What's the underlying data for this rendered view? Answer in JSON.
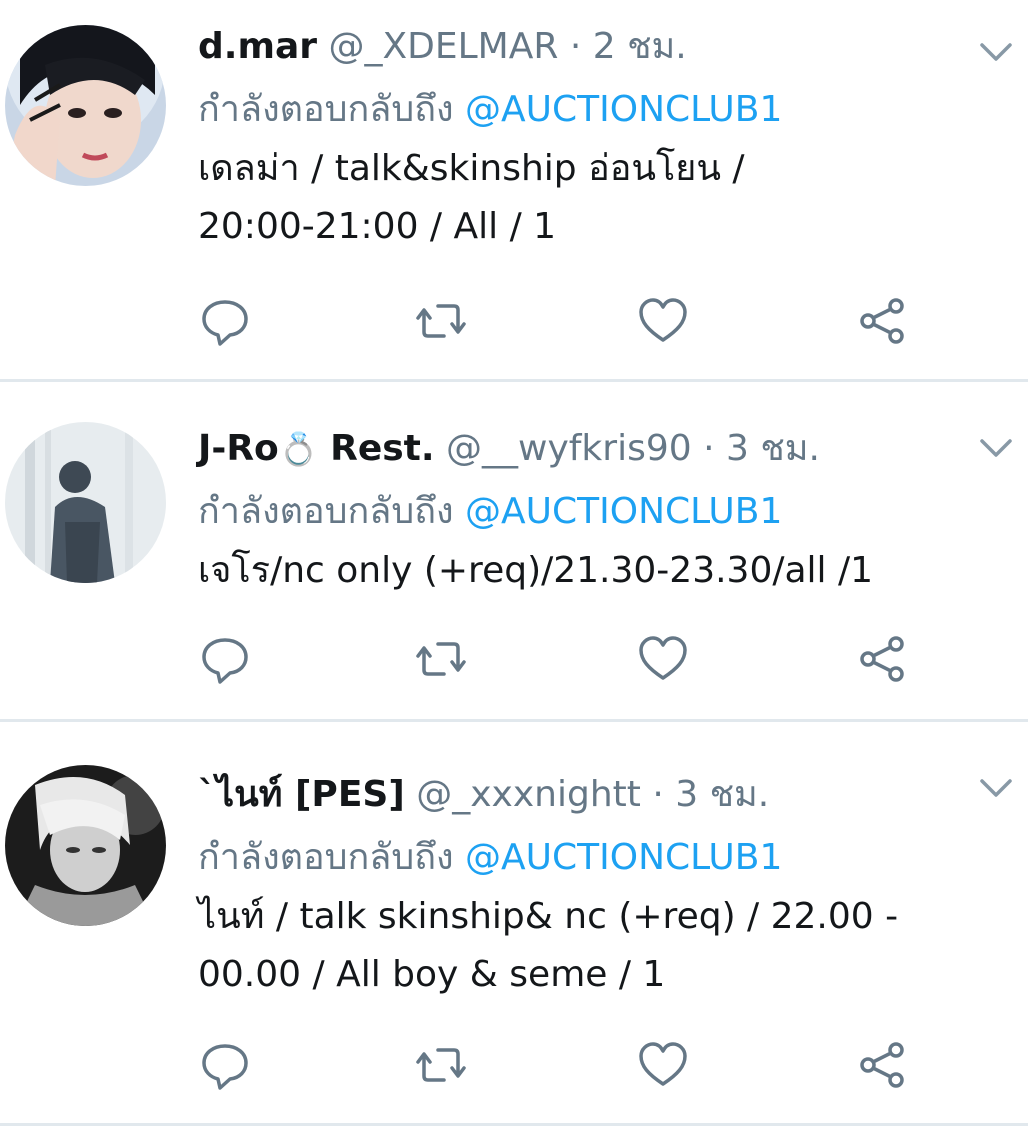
{
  "tweets": [
    {
      "name": "d.mar",
      "badge": "",
      "name_suffix": "",
      "handle": "@_XDELMAR",
      "separator": "·",
      "time": "2 ชม.",
      "replying_prefix": "กำลังตอบกลับถึง",
      "replying_to": "@AUCTIONCLUB1",
      "text_lines": [
        "เดลม่า / talk&skinship อ่อนโยน /",
        "20:00-21:00 / All / 1"
      ]
    },
    {
      "name": "J-Ro",
      "badge": "💍",
      "name_suffix": "Rest.",
      "handle": "@__wyfkris90",
      "separator": "·",
      "time": "3 ชม.",
      "replying_prefix": "กำลังตอบกลับถึง",
      "replying_to": "@AUCTIONCLUB1",
      "text_lines": [
        "เจโร/nc only (+req)/21.30-23.30/all /1"
      ]
    },
    {
      "name": "`ไนท์ [PES]",
      "badge": "",
      "name_suffix": "",
      "handle": "@_xxxnightt",
      "separator": "·",
      "time": "3 ชม.",
      "replying_prefix": "กำลังตอบกลับถึง",
      "replying_to": "@AUCTIONCLUB1",
      "text_lines": [
        "ไนท์ / talk skinship& nc (+req) / 22.00 -",
        "00.00 / All boy & seme / 1"
      ]
    }
  ],
  "icons": {
    "reply": "reply-icon",
    "retweet": "retweet-icon",
    "like": "heart-icon",
    "share": "share-icon",
    "menu": "chevron-down-icon"
  },
  "colors": {
    "text": "#14171a",
    "secondary": "#657786",
    "link": "#1da1f2",
    "divider": "#e1e8ed"
  }
}
